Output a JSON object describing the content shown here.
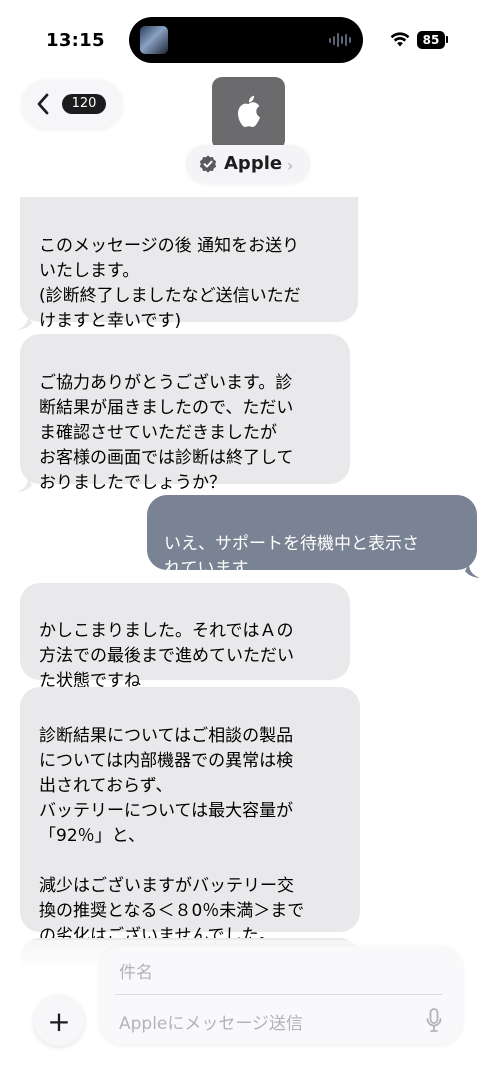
{
  "status_bar": {
    "time": "13:15",
    "battery": "85"
  },
  "header": {
    "back_count": "120",
    "contact_name": "Apple"
  },
  "messages": [
    {
      "direction": "incoming",
      "text": "このメッセージの後 通知をお送り\nいたします。\n(診断終了しましたなど送信いただ\nけますと幸いです)"
    },
    {
      "direction": "incoming",
      "text": "ご協力ありがとうございます。診\n断結果が届きましたので、ただい\nま確認させていただきましたが\nお客様の画面では診断は終了して\nおりましたでしょうか？"
    },
    {
      "direction": "outgoing",
      "text": "いえ、サポートを待機中と表示さ\nれています。"
    },
    {
      "direction": "incoming",
      "text": "かしこまりました。それではＡの\n方法での最後まで進めていただい\nた状態ですね"
    },
    {
      "direction": "incoming",
      "text": "診断結果についてはご相談の製品\nについては内部機器での異常は検\n出されておらず、\nバッテリーについては最大容量が\n「92％」と、\n\n減少はございますがバッテリー交\n換の推奨となる＜８0％未満＞まで\nの劣化はございませんでした。"
    }
  ],
  "compose": {
    "subject_placeholder": "件名",
    "message_placeholder": "Appleにメッセージ送信"
  },
  "colors": {
    "incoming_bubble": "#e9e9eb",
    "outgoing_bubble": "#7a8393",
    "avatar": "#6b6b6d"
  },
  "icons": [
    "back-chevron-icon",
    "apple-logo-icon",
    "verified-badge-icon",
    "chevron-right-icon",
    "wifi-icon",
    "plus-icon",
    "mic-icon"
  ]
}
